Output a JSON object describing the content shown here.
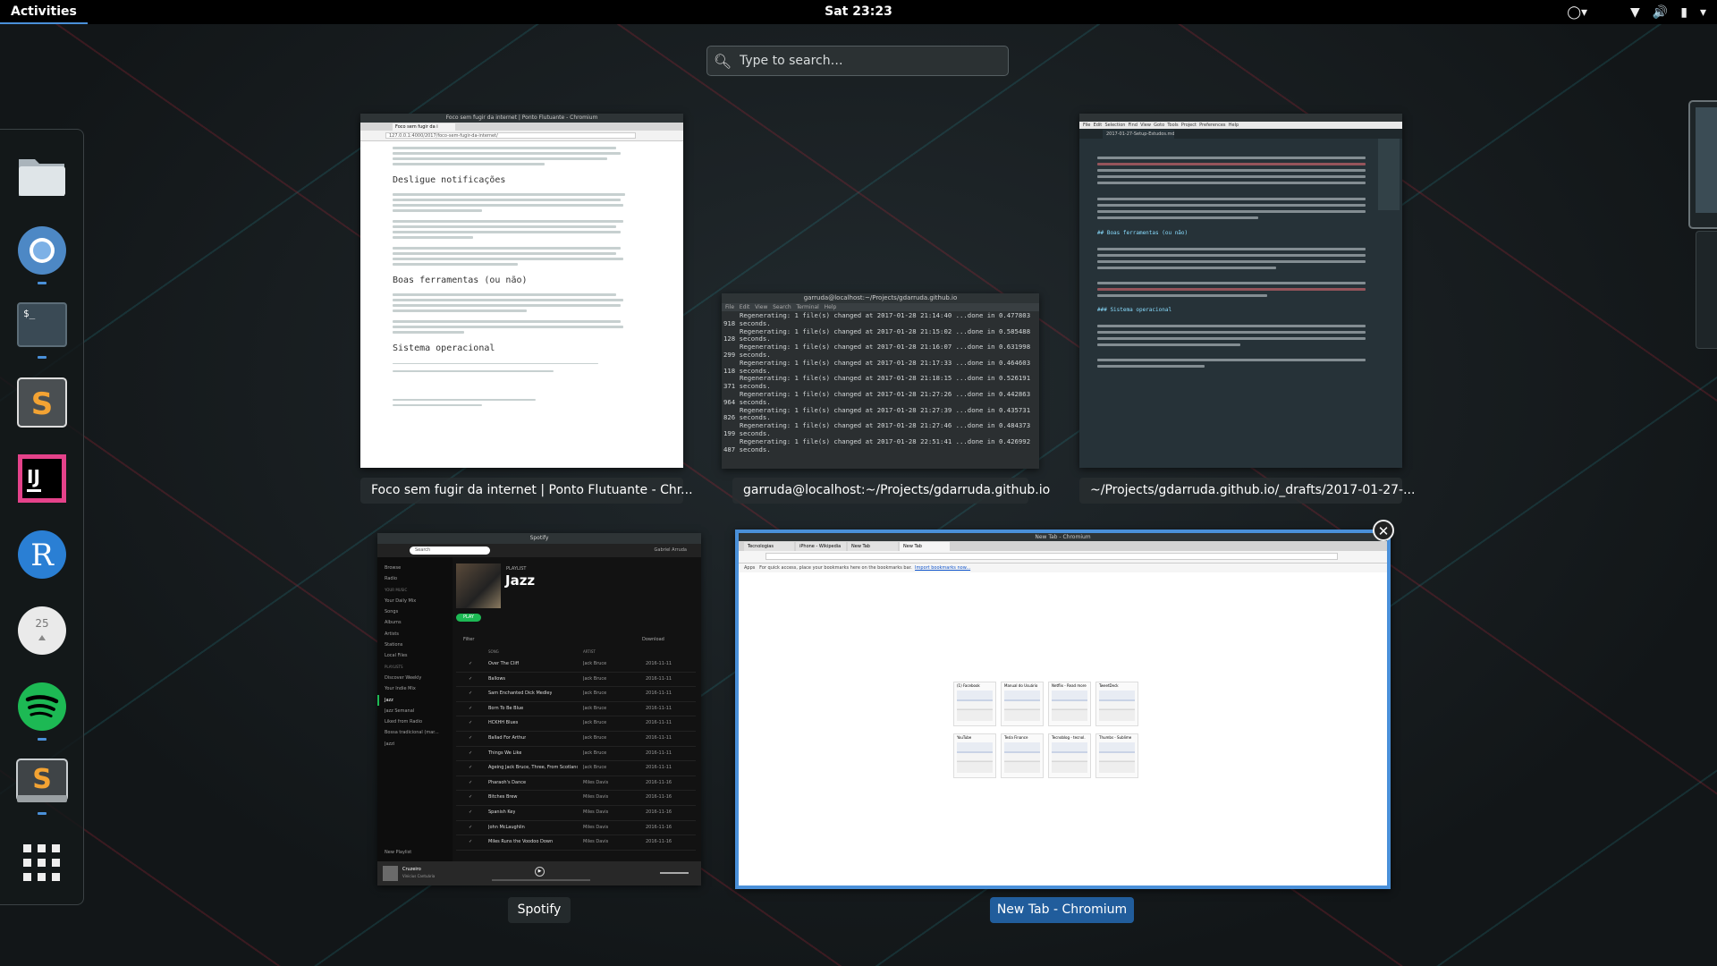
{
  "topbar": {
    "activities": "Activities",
    "clock": "Sat 23:23",
    "icons": [
      "privacy-indicator-icon",
      "wifi-icon",
      "volume-icon",
      "battery-icon",
      "chevron-down-icon"
    ]
  },
  "search": {
    "placeholder": "Type to search…"
  },
  "dash": {
    "apps": [
      {
        "name": "Files",
        "icon": "folder-icon",
        "running": false
      },
      {
        "name": "Chromium",
        "icon": "chromium-icon",
        "running": true
      },
      {
        "name": "Terminal",
        "icon": "terminal-icon",
        "running": true
      },
      {
        "name": "Sublime Text",
        "icon": "sublime-s-icon",
        "running": true
      },
      {
        "name": "IntelliJ IDEA",
        "icon": "intellij-icon",
        "running": false
      },
      {
        "name": "R",
        "icon": "r-icon",
        "running": false
      },
      {
        "name": "Calendar",
        "icon": "calendar-icon",
        "running": false,
        "label": "25"
      },
      {
        "name": "Spotify",
        "icon": "spotify-icon",
        "running": true
      },
      {
        "name": "Sublime Text",
        "icon": "sublime-box-icon",
        "running": true
      },
      {
        "name": "Show Applications",
        "icon": "app-grid-icon",
        "running": false
      }
    ]
  },
  "windows": [
    {
      "caption": "Foco sem fugir da internet | Ponto Flutuante - Chr...",
      "titlebar": "Foco sem fugir da internet | Ponto Flutuante - Chromium",
      "tab": "Foco sem fugir da i",
      "url": "127.0.0.1:4000/2017/foco-sem-fugir-da-internet/",
      "headings": [
        "Desligue notificações",
        "Boas ferramentas (ou não)",
        "Sistema operacional"
      ]
    },
    {
      "caption": "garruda@localhost:~/Projects/gdarruda.github.io",
      "titlebar": "garruda@localhost:~/Projects/gdarruda.github.io",
      "menu": [
        "File",
        "Edit",
        "View",
        "Search",
        "Terminal",
        "Help"
      ],
      "lines": [
        "Regenerating: 1 file(s) changed at 2017-01-28 21:14:40 ...done in 0.477803",
        "918 seconds.",
        "Regenerating: 1 file(s) changed at 2017-01-28 21:15:02 ...done in 0.585488",
        "128 seconds.",
        "Regenerating: 1 file(s) changed at 2017-01-28 21:16:07 ...done in 0.631998",
        "299 seconds.",
        "Regenerating: 1 file(s) changed at 2017-01-28 21:17:33 ...done in 0.464603",
        "118 seconds.",
        "Regenerating: 1 file(s) changed at 2017-01-28 21:18:15 ...done in 0.526191",
        "371 seconds.",
        "Regenerating: 1 file(s) changed at 2017-01-28 21:27:26 ...done in 0.442863",
        "964 seconds.",
        "Regenerating: 1 file(s) changed at 2017-01-28 21:27:39 ...done in 0.435731",
        "826 seconds.",
        "Regenerating: 1 file(s) changed at 2017-01-28 21:27:46 ...done in 0.484373",
        "199 seconds.",
        "Regenerating: 1 file(s) changed at 2017-01-28 22:51:41 ...done in 0.426992",
        "487 seconds."
      ]
    },
    {
      "caption": "~/Projects/gdarruda.github.io/_drafts/2017-01-27-...",
      "menu": [
        "File",
        "Edit",
        "Selection",
        "Find",
        "View",
        "Goto",
        "Tools",
        "Project",
        "Preferences",
        "Help"
      ],
      "tab": "2017-01-27-Setup-Estudos.md",
      "headings": [
        "## Boas ferramentas (ou não)",
        "### Sistema operacional"
      ]
    },
    {
      "caption": "Spotify",
      "titlebar": "Spotify",
      "search": "Search",
      "user": "Gabriel Arruda",
      "sidebar": [
        "Browse",
        "Radio",
        "YOUR MUSIC",
        "Your Daily Mix",
        "Songs",
        "Albums",
        "Artists",
        "Stations",
        "Local Files",
        "PLAYLISTS",
        "Discover Weekly",
        "Your Indie Mix",
        "Jazz",
        "Jazz Semanal",
        "Liked from Radio",
        "Bossa tradicional (mar...",
        "Jazzi"
      ],
      "playlist_kicker": "PLAYLIST",
      "playlist_title": "Jazz",
      "play": "PLAY",
      "filter": "Filter",
      "download": "Download",
      "columns": [
        "SONG",
        "ARTIST"
      ],
      "tracks": [
        [
          "Over The Cliff",
          "Jack Bruce",
          "2016-11-11"
        ],
        [
          "Ballows",
          "Jack Bruce",
          "2016-11-11"
        ],
        [
          "Sam Enchanted Dick Medley",
          "Jack Bruce",
          "2016-11-11"
        ],
        [
          "Born To Be Blue",
          "Jack Bruce",
          "2016-11-11"
        ],
        [
          "HCKHH Blues",
          "Jack Bruce",
          "2016-11-11"
        ],
        [
          "Ballad For Arthur",
          "Jack Bruce",
          "2016-11-11"
        ],
        [
          "Things We Like",
          "Jack Bruce",
          "2016-11-11"
        ],
        [
          "Ageing Jack Bruce, Three, From Scotland, England",
          "Jack Bruce",
          "2016-11-11"
        ],
        [
          "Pharaoh's Dance",
          "Miles Davis",
          "2016-11-16"
        ],
        [
          "Bitches Brew",
          "Miles Davis",
          "2016-11-16"
        ],
        [
          "Spanish Key",
          "Miles Davis",
          "2016-11-16"
        ],
        [
          "John McLaughlin",
          "Miles Davis",
          "2016-11-16"
        ],
        [
          "Miles Runs the Voodoo Down",
          "Miles Davis",
          "2016-11-16"
        ],
        [
          "Sanctuary",
          "Miles Davis",
          "2016-11-16"
        ]
      ],
      "now_playing": [
        "Cruzeiro",
        "Vinicius Cantuária"
      ],
      "new_playlist": "New Playlist"
    },
    {
      "caption": "New Tab - Chromium",
      "titlebar": "New Tab - Chromium",
      "tabs": [
        "Tecnologias",
        "iPhone - Wikipedia",
        "New Tab",
        "New Tab"
      ],
      "bookmarks_hint": "For quick access, place your bookmarks here on the bookmarks bar.",
      "bookmarks_link": "Import bookmarks now...",
      "apps_label": "Apps",
      "tiles": [
        "(1) Facebook",
        "Manual do Usuário",
        "Netflix - Read more",
        "TweetDeck",
        "YouTube",
        "Tesla Finance",
        "Tecnoblog - tecnol.",
        "Thumbs - Sublime"
      ]
    }
  ],
  "colors": {
    "accent": "#4a90d9",
    "active_caption": "#215d9c",
    "spotify_green": "#1db954"
  }
}
